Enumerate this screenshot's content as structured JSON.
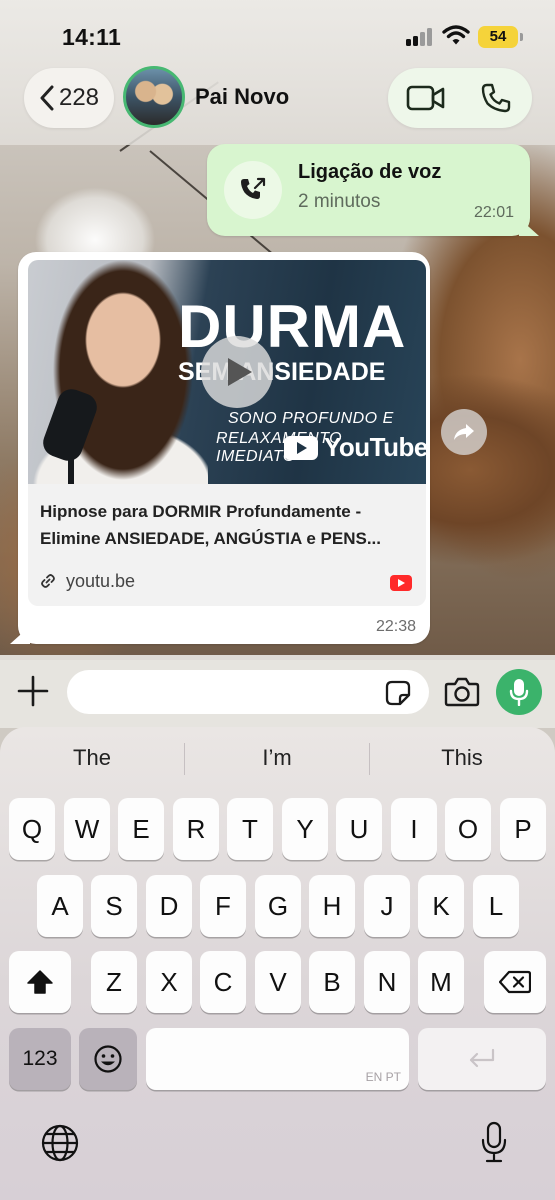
{
  "status_bar": {
    "time": "14:11",
    "battery": "54"
  },
  "header": {
    "back_count": "228",
    "contact_name": "Pai Novo"
  },
  "messages": {
    "voice_call": {
      "title": "Ligação de voz",
      "duration": "2 minutos",
      "time": "22:01"
    },
    "link": {
      "thumbnail": {
        "headline": "DURMA",
        "subheadline": "SEM ANSIEDADE",
        "line1": "SONO PROFUNDO E",
        "line2": "RELAXAMENTO IMEDIATO",
        "brand": "YouTube"
      },
      "title_line1": "Hipnose para DORMIR Profundamente -",
      "title_line2": "Elimine ANSIEDADE, ANGÚSTIA e PENS...",
      "domain": "youtu.be",
      "time": "22:38"
    }
  },
  "composer": {
    "input_value": ""
  },
  "keyboard": {
    "suggestions": [
      "The",
      "I’m",
      "This"
    ],
    "row1": [
      "Q",
      "W",
      "E",
      "R",
      "T",
      "Y",
      "U",
      "I",
      "O",
      "P"
    ],
    "row2": [
      "A",
      "S",
      "D",
      "F",
      "G",
      "H",
      "J",
      "K",
      "L"
    ],
    "row3": [
      "Z",
      "X",
      "C",
      "V",
      "B",
      "N",
      "M"
    ],
    "numbers_label": "123",
    "space_hint": "EN PT"
  }
}
